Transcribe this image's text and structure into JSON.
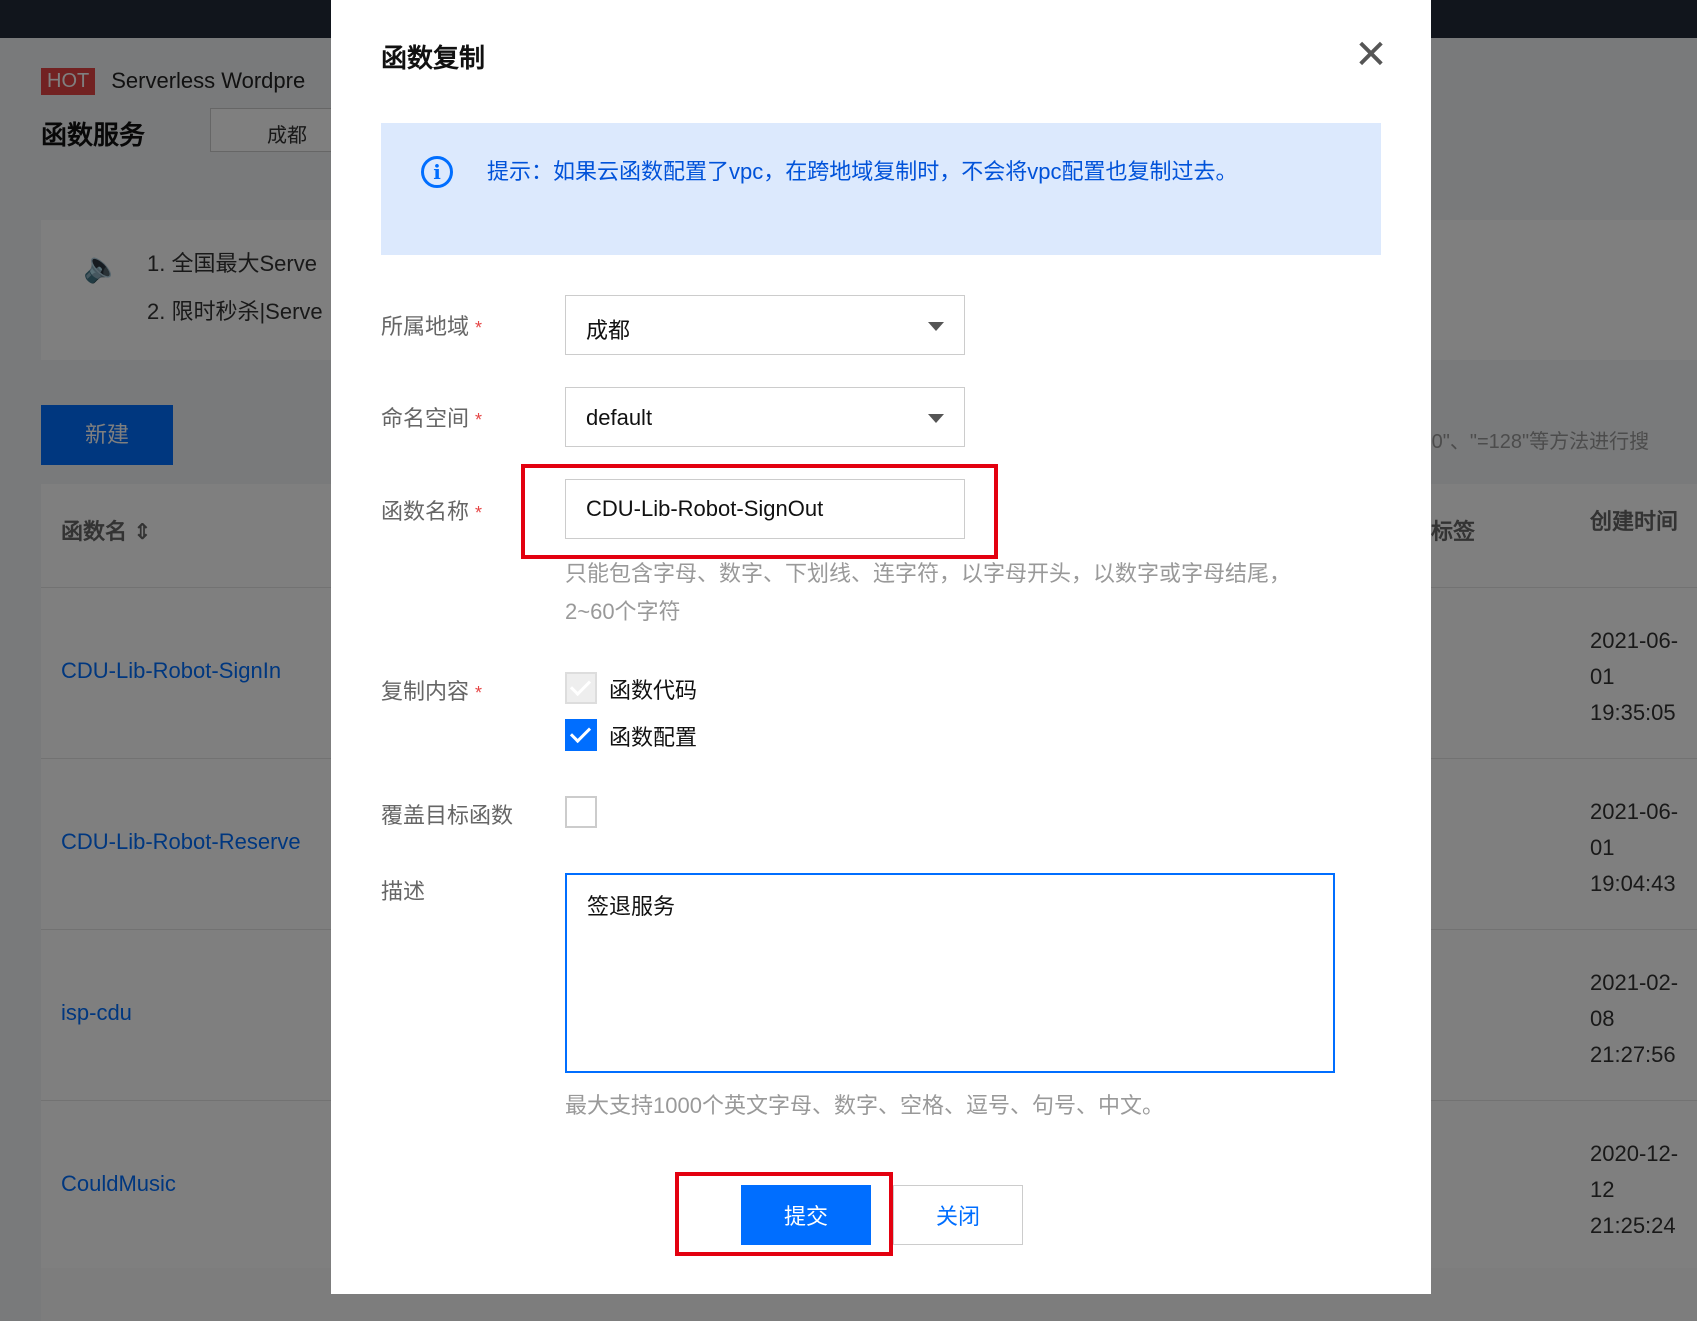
{
  "background": {
    "hot_badge": "HOT",
    "hot_text": "Serverless Wordpre",
    "page_title": "函数服务",
    "region_chip": "成都",
    "notices": [
      "1. 全国最大Serve",
      "2. 限时秒杀|Serve"
    ],
    "new_button": "新建",
    "search_hint": ">0\"、\"=128\"等方法进行搜",
    "table": {
      "col_name": "函数名",
      "col_tag": "标签",
      "col_created": "创建时间",
      "rows": [
        {
          "name": "CDU-Lib-Robot-SignIn",
          "created": "2021-06-01 19:35:05"
        },
        {
          "name": "CDU-Lib-Robot-Reserve",
          "created": "2021-06-01 19:04:43"
        },
        {
          "name": "isp-cdu",
          "created": "2021-02-08 21:27:56"
        },
        {
          "name": "CouldMusic",
          "created": "2020-12-12 21:25:24"
        }
      ]
    }
  },
  "dialog": {
    "title": "函数复制",
    "close_glyph": "✕",
    "tip": "提示：如果云函数配置了vpc，在跨地域复制时，不会将vpc配置也复制过去。",
    "fields": {
      "region_label": "所属地域",
      "region_value": "成都",
      "namespace_label": "命名空间",
      "namespace_value": "default",
      "name_label": "函数名称",
      "name_value": "CDU-Lib-Robot-SignOut",
      "name_help": "只能包含字母、数字、下划线、连字符，以字母开头，以数字或字母结尾，2~60个字符",
      "copy_label": "复制内容",
      "copy_code": "函数代码",
      "copy_config": "函数配置",
      "overwrite_label": "覆盖目标函数",
      "desc_label": "描述",
      "desc_value": "签退服务",
      "desc_help": "最大支持1000个英文字母、数字、空格、逗号、句号、中文。"
    },
    "required_mark": "*",
    "submit": "提交",
    "close": "关闭"
  },
  "colors": {
    "accent": "#006eff",
    "highlight": "#e3000f",
    "tip_bg": "#dce9fd"
  }
}
